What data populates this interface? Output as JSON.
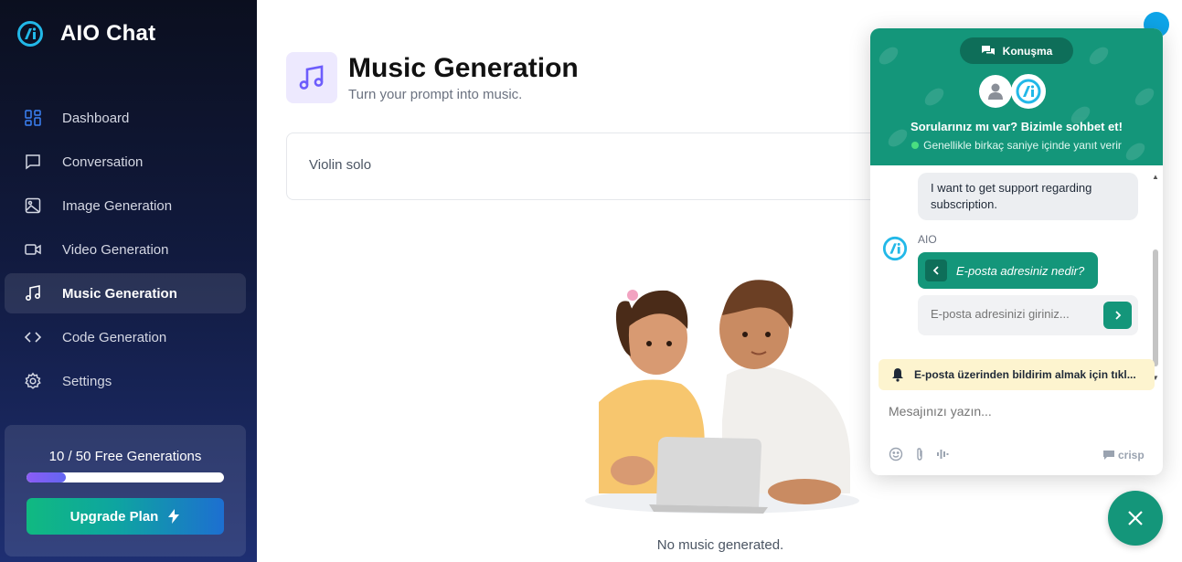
{
  "app": {
    "name": "AIO Chat"
  },
  "sidebar": {
    "items": [
      {
        "label": "Dashboard",
        "icon": "dashboard-icon",
        "active": false
      },
      {
        "label": "Conversation",
        "icon": "message-icon",
        "active": false
      },
      {
        "label": "Image Generation",
        "icon": "image-icon",
        "active": false
      },
      {
        "label": "Video Generation",
        "icon": "video-icon",
        "active": false
      },
      {
        "label": "Music Generation",
        "icon": "music-icon",
        "active": true
      },
      {
        "label": "Code Generation",
        "icon": "code-icon",
        "active": false
      },
      {
        "label": "Settings",
        "icon": "settings-icon",
        "active": false
      }
    ],
    "plan": {
      "usage_text": "10 / 50 Free Generations",
      "used": 10,
      "limit": 50,
      "upgrade_label": "Upgrade Plan"
    }
  },
  "main": {
    "title": "Music Generation",
    "subtitle": "Turn your prompt into music.",
    "prompt_value": "Violin solo",
    "empty_text": "No music generated."
  },
  "chat": {
    "tab_label": "Konuşma",
    "headline": "Sorularınız mı var? Bizimle sohbet et!",
    "status": "Genellikle birkaç saniye içinde yanıt verir",
    "user_message": "I want to get support regarding subscription.",
    "bot_name": "AIO",
    "bot_question": "E-posta adresiniz nedir?",
    "email_placeholder": "E-posta adresinizi giriniz...",
    "notify_text": "E-posta üzerinden bildirim almak için tıkl...",
    "compose_placeholder": "Mesajınızı yazın...",
    "brand": "crisp"
  },
  "colors": {
    "sidebar_top": "#0b0f1f",
    "sidebar_bottom": "#1e2f72",
    "chat_green": "#14967a",
    "accent_purple": "#6366f1",
    "notify_yellow": "#fdf4cf"
  }
}
